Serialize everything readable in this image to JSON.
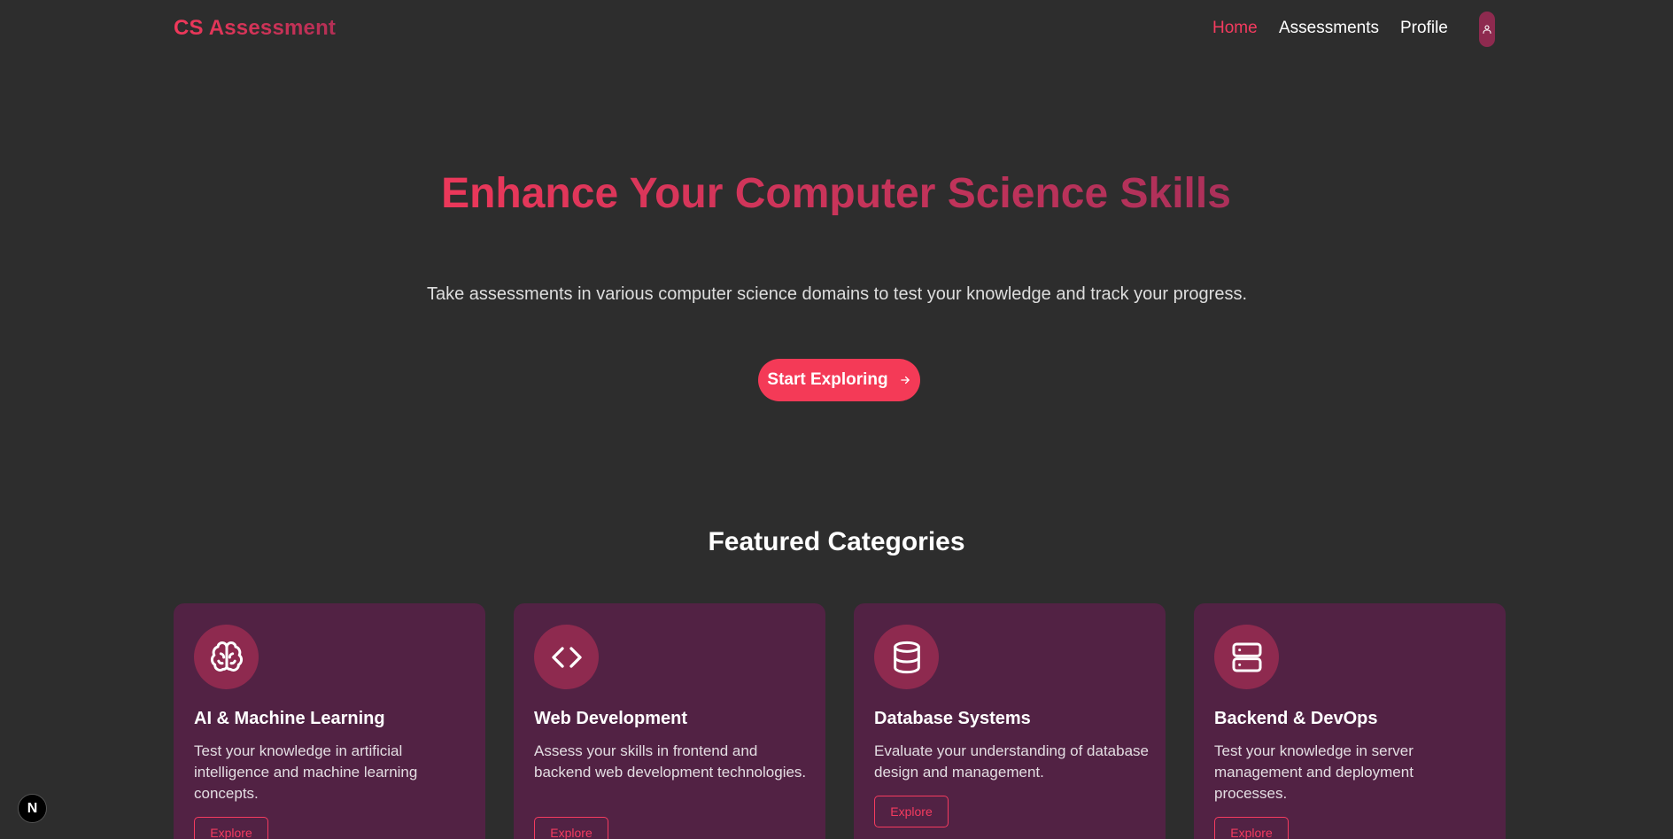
{
  "header": {
    "logo": "CS Assessment",
    "nav": {
      "home": "Home",
      "assessments": "Assessments",
      "profile": "Profile"
    }
  },
  "hero": {
    "title": "Enhance Your Computer Science Skills",
    "subtitle": "Take assessments in various computer science domains to test your knowledge and track your progress.",
    "cta_label": "Start Exploring"
  },
  "featured": {
    "title": "Featured Categories",
    "cards": [
      {
        "icon": "brain-icon",
        "title": "AI & Machine Learning",
        "description": "Test your knowledge in artificial intelligence and machine learning concepts.",
        "button": "Explore"
      },
      {
        "icon": "code-icon",
        "title": "Web Development",
        "description": "Assess your skills in frontend and backend web development technologies.",
        "button": "Explore"
      },
      {
        "icon": "database-icon",
        "title": "Database Systems",
        "description": "Evaluate your understanding of database design and management.",
        "button": "Explore"
      },
      {
        "icon": "server-icon",
        "title": "Backend & DevOps",
        "description": "Test your knowledge in server management and deployment processes.",
        "button": "Explore"
      }
    ]
  },
  "dev_badge": "N",
  "colors": {
    "background": "#2d2d2d",
    "accent": "#f43b5f",
    "card": "#522244",
    "icon_circle": "#8e2a4f"
  }
}
